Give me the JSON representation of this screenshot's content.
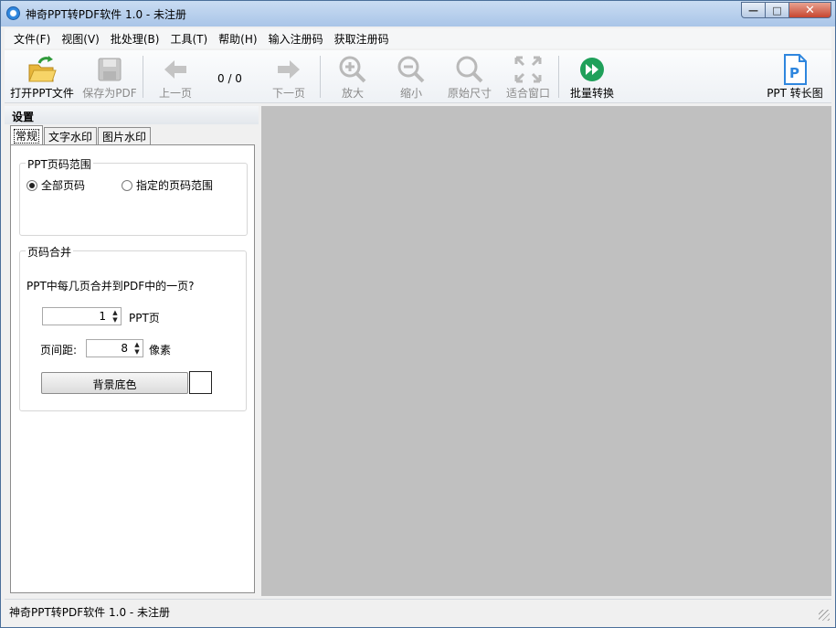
{
  "window": {
    "title": "神奇PPT转PDF软件 1.0 - 未注册"
  },
  "menu": [
    "文件(F)",
    "视图(V)",
    "批处理(B)",
    "工具(T)",
    "帮助(H)",
    "输入注册码",
    "获取注册码"
  ],
  "toolbar": {
    "open": "打开PPT文件",
    "save": "保存为PDF",
    "prev": "上一页",
    "page_count": "0 / 0",
    "next": "下一页",
    "zoom_in": "放大",
    "zoom_out": "缩小",
    "actual_size": "原始尺寸",
    "fit_window": "适合窗口",
    "batch": "批量转换",
    "long_image": "PPT 转长图"
  },
  "panel": {
    "title": "设置",
    "tabs": [
      "常规",
      "文字水印",
      "图片水印"
    ],
    "range": {
      "title": "PPT页码范围",
      "all": "全部页码",
      "specified": "指定的页码范围",
      "selected": "all"
    },
    "merge": {
      "title": "页码合并",
      "question": "PPT中每几页合并到PDF中的一页?",
      "pages_value": "1",
      "pages_unit": "PPT页",
      "spacing_label": "页间距:",
      "spacing_value": "8",
      "spacing_unit": "像素",
      "bg_button": "背景底色",
      "bg_color": "#ffffff"
    }
  },
  "status": "神奇PPT转PDF软件 1.0 - 未注册",
  "colors": {
    "viewer_bg": "#c0c0c0",
    "accent_green": "#1fa05a",
    "accent_blue": "#2e86de"
  }
}
